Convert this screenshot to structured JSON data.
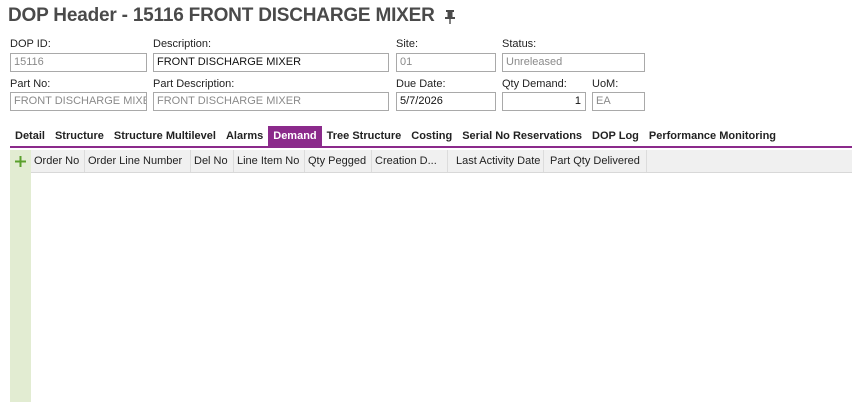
{
  "header": {
    "title": "DOP Header - 15116 FRONT DISCHARGE MIXER",
    "pin_icon": "pin-icon"
  },
  "form": {
    "dop_id": {
      "label": "DOP ID:",
      "value": "15116"
    },
    "description": {
      "label": "Description:",
      "value": "FRONT DISCHARGE MIXER"
    },
    "site": {
      "label": "Site:",
      "value": "01"
    },
    "status": {
      "label": "Status:",
      "value": "Unreleased"
    },
    "part_no": {
      "label": "Part No:",
      "value": "FRONT DISCHARGE MIXER"
    },
    "part_description": {
      "label": "Part Description:",
      "value": "FRONT DISCHARGE MIXER"
    },
    "due_date": {
      "label": "Due Date:",
      "value": "5/7/2026"
    },
    "qty_demand": {
      "label": "Qty Demand:",
      "value": "1"
    },
    "uom": {
      "label": "UoM:",
      "value": "EA"
    }
  },
  "tabs": [
    {
      "label": "Detail"
    },
    {
      "label": "Structure"
    },
    {
      "label": "Structure Multilevel"
    },
    {
      "label": "Alarms"
    },
    {
      "label": "Demand",
      "active": true
    },
    {
      "label": "Tree Structure"
    },
    {
      "label": "Costing"
    },
    {
      "label": "Serial No Reservations"
    },
    {
      "label": "DOP Log"
    },
    {
      "label": "Performance Monitoring"
    }
  ],
  "grid": {
    "add_icon": "plus-icon",
    "columns": [
      "Order No",
      "Order Line Number",
      "Del No",
      "Line Item No",
      "Qty Pegged",
      "Creation D...",
      "Last Activity Date",
      "Part Qty Delivered"
    ]
  },
  "colors": {
    "accent": "#8b2a8b",
    "gutter": "#e2ecd2",
    "add": "#5aa02c"
  }
}
